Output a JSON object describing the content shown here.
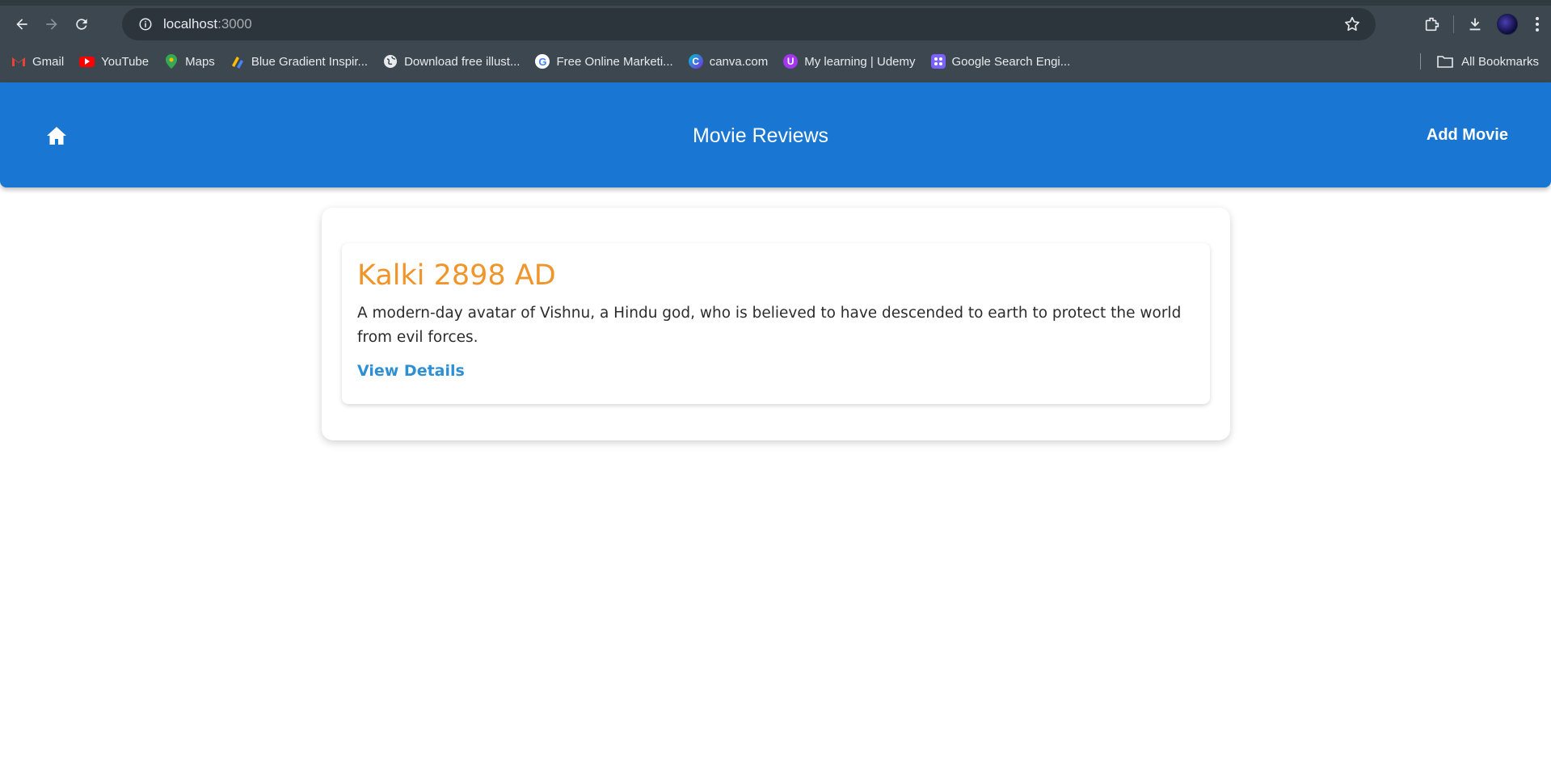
{
  "browser": {
    "url_host": "localhost",
    "url_port": ":3000",
    "bookmarks": [
      {
        "label": "Gmail",
        "icon": "gmail-icon",
        "color": "#ea4335"
      },
      {
        "label": "YouTube",
        "icon": "youtube-icon",
        "color": "#ff0000"
      },
      {
        "label": "Maps",
        "icon": "maps-icon",
        "color": "#34a853"
      },
      {
        "label": "Blue Gradient Inspir...",
        "icon": "gradient-icon",
        "color": "#fbbc04"
      },
      {
        "label": "Download free illust...",
        "icon": "globe-icon",
        "color": "#e8eaed"
      },
      {
        "label": "Free Online Marketi...",
        "icon": "google-icon",
        "color": "#4285f4"
      },
      {
        "label": "canva.com",
        "icon": "canva-icon",
        "color": "#00c4cc"
      },
      {
        "label": "My learning | Udemy",
        "icon": "udemy-icon",
        "color": "#a435f0"
      },
      {
        "label": "Google Search Engi...",
        "icon": "grid-icon",
        "color": "#7b61ff"
      }
    ],
    "all_bookmarks": "All Bookmarks"
  },
  "header": {
    "title": "Movie Reviews",
    "add_movie": "Add Movie"
  },
  "movies": [
    {
      "title": "Kalki 2898 AD",
      "description": "A modern-day avatar of Vishnu, a Hindu god, who is believed to have descended to earth to protect the world from evil forces.",
      "link": "View Details"
    }
  ],
  "colors": {
    "header_bg": "#1976d2",
    "movie_title": "#f0952a",
    "link": "#2f8fd3"
  }
}
